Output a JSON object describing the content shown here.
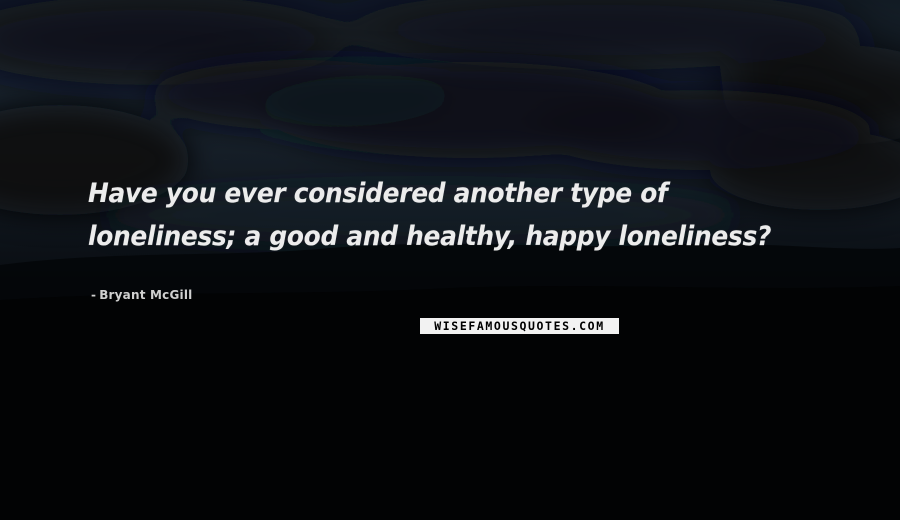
{
  "quote": {
    "text": "Have you ever considered another type of loneliness; a good and healthy, happy loneliness?",
    "author_dash": "-",
    "author": "Bryant McGill"
  },
  "watermark": {
    "text": "WISEFAMOUSQUOTES.COM"
  },
  "colors": {
    "sky_top": "#131c25",
    "sky_mid": "#0c1117",
    "ground": "#000000",
    "quote_text": "#ececec",
    "author_text": "#d0d0d0",
    "watermark_bg": "#f2f2f2",
    "watermark_text": "#000000"
  }
}
